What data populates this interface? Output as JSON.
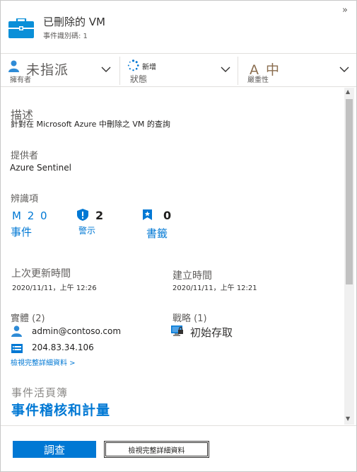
{
  "header": {
    "title": "已刪除的 VM",
    "subtitle": "事件識別碼: 1",
    "collapse_glyph": "»",
    "icon": "briefcase-icon"
  },
  "status_bar": {
    "owner": {
      "value": "未指派",
      "label": "擁有者"
    },
    "status": {
      "value": "新增",
      "label": "狀態"
    },
    "severity": {
      "value": "A 中",
      "label": "嚴重性"
    }
  },
  "description": {
    "label": "描述",
    "text": "針對在 Microsoft Azure 中刪除之 VM 的查詢"
  },
  "provider": {
    "label": "提供者",
    "value": "Azure Sentinel"
  },
  "evidence": {
    "label": "辨識項",
    "events": {
      "count": "M 2 0",
      "label": "事件"
    },
    "alerts": {
      "count": "2",
      "label": "警示"
    },
    "bookmarks": {
      "count": "0",
      "label": "書籤"
    }
  },
  "last_update": {
    "label": "上次更新時間",
    "value": "2020/11/11，上午 12:26"
  },
  "created": {
    "label": "建立時間",
    "value": "2020/11/11，上午 12:21"
  },
  "entities": {
    "label": "實體 (2)",
    "items": [
      {
        "value": "admin@contoso.com",
        "icon": "user-icon"
      },
      {
        "value": "204.83.34.106",
        "icon": "ip-address-icon"
      }
    ],
    "view_details": "檢視完整詳細資料 >"
  },
  "tactics": {
    "label": "戰略 (1)",
    "items": [
      {
        "value": "初始存取",
        "icon": "initial-access-icon"
      }
    ]
  },
  "workbook": {
    "label": "事件活頁簿",
    "link": "事件稽核和計量"
  },
  "footer": {
    "investigate": "調查",
    "view_full_details": "檢視完整詳細資料"
  },
  "colors": {
    "accent": "#0078d4",
    "briefcase": "#0a8fd8",
    "primary_button": "#0078d4",
    "owner_icon": "#2e8bd6"
  }
}
